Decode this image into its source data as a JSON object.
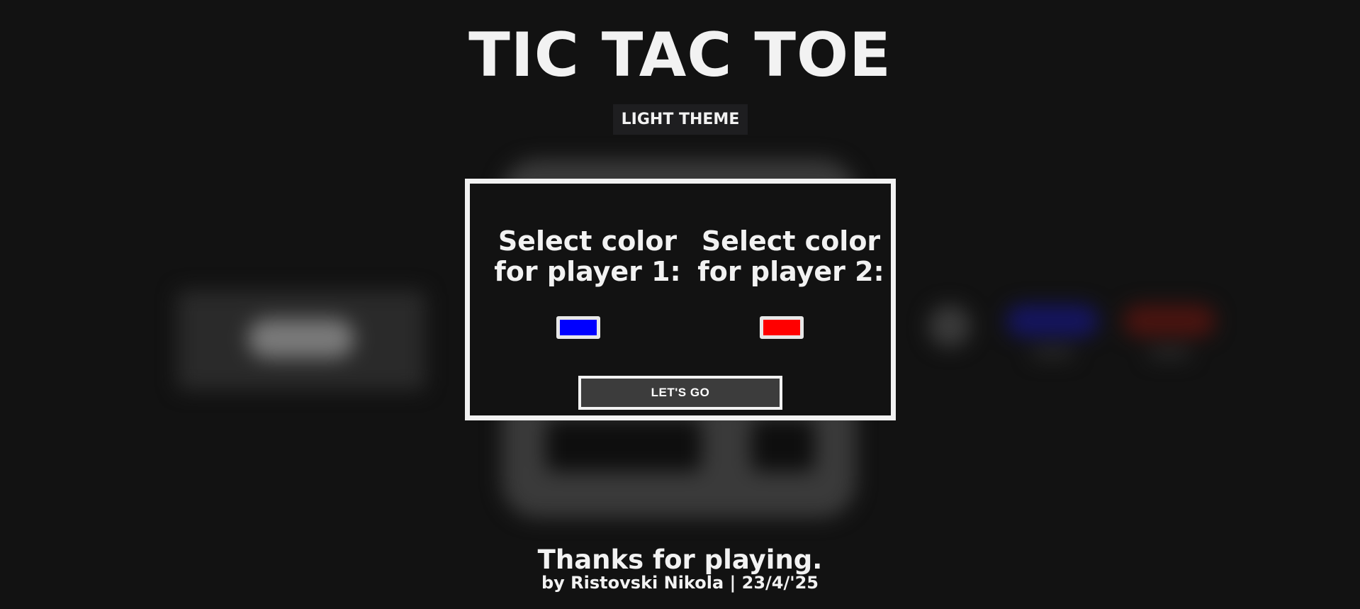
{
  "header": {
    "title": "TIC TAC TOE",
    "theme_button_label": "LIGHT THEME"
  },
  "modal": {
    "player1": {
      "label_line1": "Select color",
      "label_line2": "for player 1:",
      "color": "#0000ff"
    },
    "player2": {
      "label_line1": "Select color",
      "label_line2": "for player 2:",
      "color": "#ff0000"
    },
    "start_button_label": "LET'S GO"
  },
  "footer": {
    "thanks": "Thanks for playing.",
    "credits": "by Ristovski Nikola | 23/4/'25"
  },
  "colors": {
    "background": "#121212",
    "text": "#f2f2f2",
    "modal_border": "#f2f2f2",
    "button_bg": "#3c3c3c"
  }
}
